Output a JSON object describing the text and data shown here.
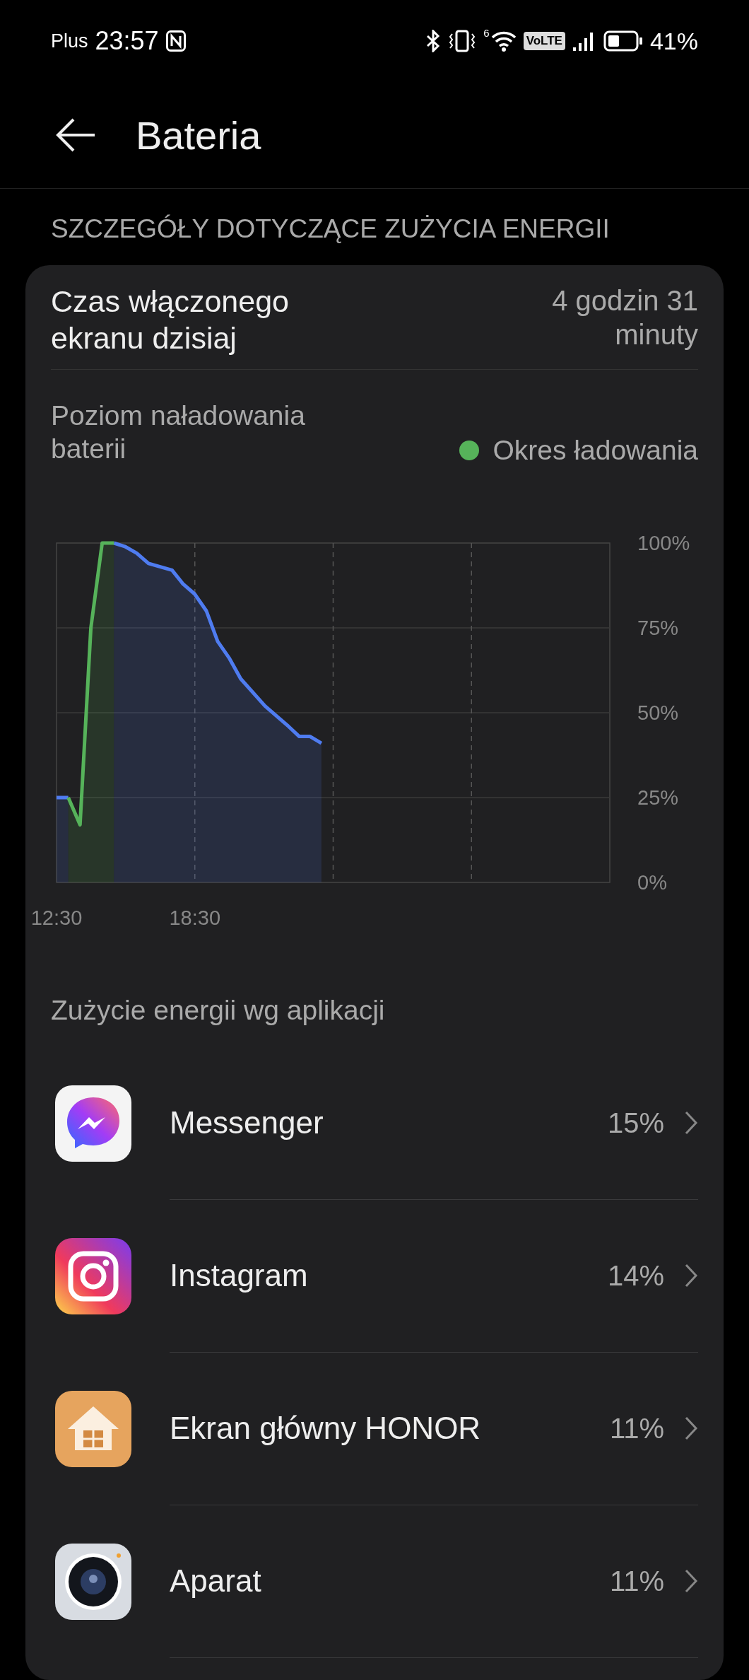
{
  "status_bar": {
    "carrier": "Plus",
    "time": "23:57",
    "wifi_badge": "6",
    "volte": "VoLTE",
    "battery": "41%"
  },
  "header": {
    "title": "Bateria"
  },
  "section_title": "SZCZEGÓŁY DOTYCZĄCE ZUŻYCIA ENERGII",
  "screen_time": {
    "label": "Czas włączonego ekranu dzisiaj",
    "value": "4 godzin 31 minuty"
  },
  "battery_chart": {
    "title": "Poziom naładowania baterii",
    "chart_data": {
      "type": "area",
      "x": [
        12.5,
        13.01,
        13.52,
        13.99,
        14.48,
        14.99,
        15.46,
        15.98,
        16.49,
        17.51,
        17.98,
        18.49,
        19.0,
        19.49,
        20.0,
        20.49,
        21.54,
        22.56,
        23.03,
        23.5,
        23.99
      ],
      "series": [
        {
          "color": "#4f7cf0",
          "values": [
            25,
            25,
            null,
            null,
            null,
            100,
            99,
            97,
            94,
            92,
            88,
            85,
            80,
            71,
            66,
            60,
            52,
            46,
            43,
            43,
            41
          ]
        },
        {
          "name": "Okres ładowania",
          "color": "#56b35a",
          "values": [
            null,
            25,
            17,
            75,
            100,
            100,
            null,
            null,
            null,
            null,
            null,
            null,
            null,
            null,
            null,
            null,
            null,
            null,
            null,
            null,
            null
          ]
        }
      ],
      "xlim": [
        12.5,
        36.5
      ],
      "ylim": [
        0,
        100
      ],
      "grid": true,
      "xticks": [
        {
          "value": 12.5,
          "label": "12:30"
        },
        {
          "value": 18.5,
          "label": "18:30"
        }
      ],
      "yticks": [
        {
          "value": 100,
          "label": "100%"
        },
        {
          "value": 75,
          "label": "75%"
        },
        {
          "value": 50,
          "label": "50%"
        },
        {
          "value": 25,
          "label": "25%"
        },
        {
          "value": 0,
          "label": "0%"
        }
      ]
    }
  },
  "apps_title": "Zużycie energii wg aplikacji",
  "apps": [
    {
      "kind": "messenger",
      "name": "Messenger",
      "percent": "15%"
    },
    {
      "kind": "instagram",
      "name": "Instagram",
      "percent": "14%"
    },
    {
      "kind": "home",
      "name": "Ekran główny HONOR",
      "percent": "11%"
    },
    {
      "kind": "camera",
      "name": "Aparat",
      "percent": "11%"
    }
  ]
}
